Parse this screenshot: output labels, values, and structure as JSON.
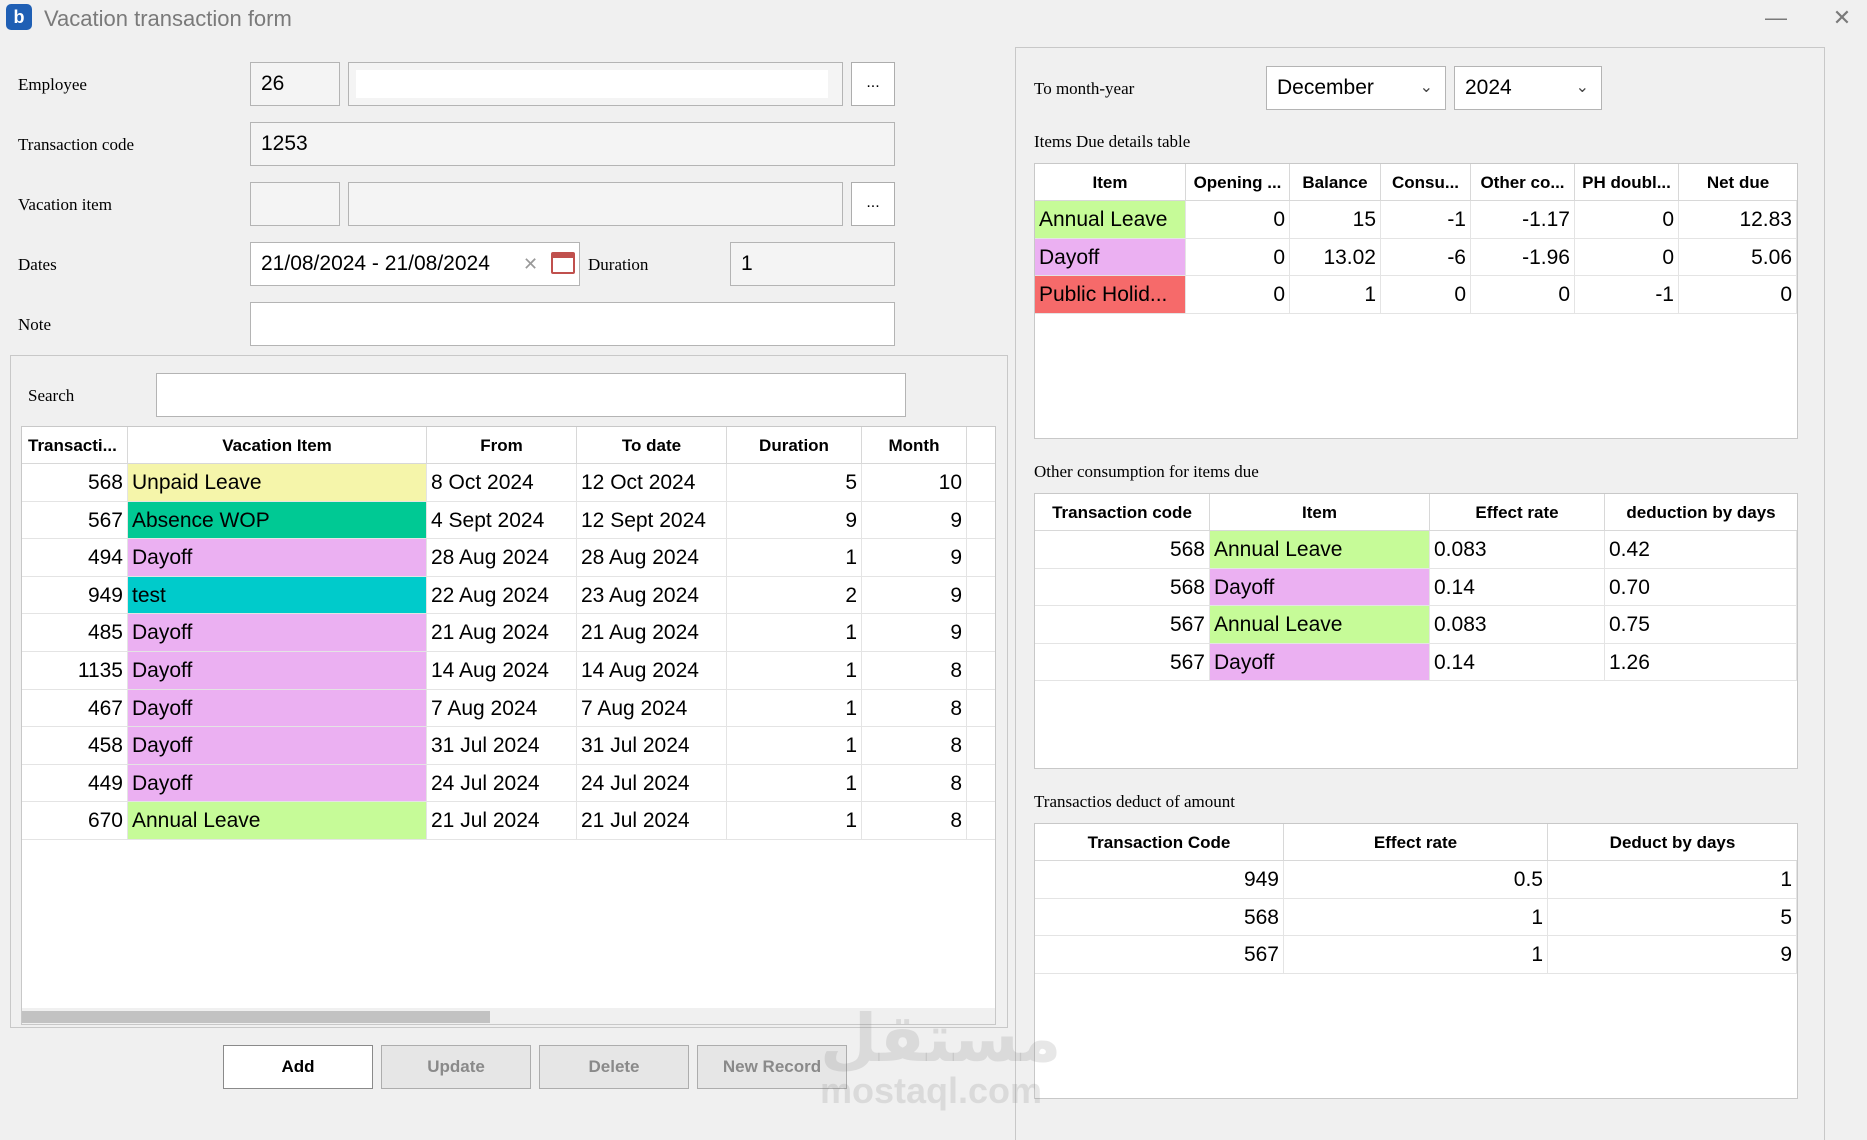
{
  "window": {
    "title": "Vacation transaction form",
    "app_icon": "app-logo-icon",
    "minimize": "—",
    "close": "✕"
  },
  "form": {
    "employee_label": "Employee",
    "employee_id": "26",
    "employee_name": "",
    "transaction_code_label": "Transaction code",
    "transaction_code": "1253",
    "vacation_item_label": "Vacation item",
    "vacation_item_code": "",
    "vacation_item_name": "",
    "dates_label": "Dates",
    "dates_value": "21/08/2024 - 21/08/2024",
    "duration_label": "Duration",
    "duration_value": "1",
    "note_label": "Note",
    "note_value": "",
    "browse": "..."
  },
  "search": {
    "label": "Search",
    "value": ""
  },
  "transactions": {
    "columns": [
      "Transacti...",
      "Vacation Item",
      "From",
      "To date",
      "Duration",
      "Month"
    ],
    "rows": [
      {
        "code": "568",
        "item": "Unpaid Leave",
        "color": "#f5f5aa",
        "from": "8 Oct 2024",
        "to": "12 Oct 2024",
        "duration": "5",
        "month": "10"
      },
      {
        "code": "567",
        "item": "Absence WOP",
        "color": "#00c994",
        "from": "4 Sept 2024",
        "to": "12 Sept 2024",
        "duration": "9",
        "month": "9"
      },
      {
        "code": "494",
        "item": "Dayoff",
        "color": "#ebb0f2",
        "from": "28 Aug 2024",
        "to": "28 Aug 2024",
        "duration": "1",
        "month": "9"
      },
      {
        "code": "949",
        "item": "test",
        "color": "#00cbcb",
        "from": "22 Aug 2024",
        "to": "23 Aug 2024",
        "duration": "2",
        "month": "9"
      },
      {
        "code": "485",
        "item": "Dayoff",
        "color": "#ebb0f2",
        "from": "21 Aug 2024",
        "to": "21 Aug 2024",
        "duration": "1",
        "month": "9"
      },
      {
        "code": "1135",
        "item": "Dayoff",
        "color": "#ebb0f2",
        "from": "14 Aug 2024",
        "to": "14 Aug 2024",
        "duration": "1",
        "month": "8"
      },
      {
        "code": "467",
        "item": "Dayoff",
        "color": "#ebb0f2",
        "from": "7 Aug 2024",
        "to": "7 Aug 2024",
        "duration": "1",
        "month": "8"
      },
      {
        "code": "458",
        "item": "Dayoff",
        "color": "#ebb0f2",
        "from": "31 Jul 2024",
        "to": "31 Jul 2024",
        "duration": "1",
        "month": "8"
      },
      {
        "code": "449",
        "item": "Dayoff",
        "color": "#ebb0f2",
        "from": "24 Jul 2024",
        "to": "24 Jul 2024",
        "duration": "1",
        "month": "8"
      },
      {
        "code": "670",
        "item": "Annual Leave",
        "color": "#c6fb98",
        "from": "21 Jul 2024",
        "to": "21 Jul 2024",
        "duration": "1",
        "month": "8"
      }
    ]
  },
  "buttons": {
    "add": "Add",
    "update": "Update",
    "delete": "Delete",
    "new_record": "New Record"
  },
  "right": {
    "to_month_year_label": "To month-year",
    "month": "December",
    "year": "2024",
    "items_due_title": "Items Due details table",
    "items_due": {
      "columns": [
        "Item",
        "Opening ...",
        "Balance",
        "Consu...",
        "Other co...",
        "PH doubl...",
        "Net due"
      ],
      "rows": [
        {
          "item": "Annual Leave",
          "color": "#c6fb98",
          "opening": "0",
          "balance": "15",
          "consumed": "-1",
          "other": "-1.17",
          "ph": "0",
          "net": "12.83"
        },
        {
          "item": "Dayoff",
          "color": "#ebb0f2",
          "opening": "0",
          "balance": "13.02",
          "consumed": "-6",
          "other": "-1.96",
          "ph": "0",
          "net": "5.06"
        },
        {
          "item": "Public Holid...",
          "color": "#f66a6a",
          "opening": "0",
          "balance": "1",
          "consumed": "0",
          "other": "0",
          "ph": "-1",
          "net": "0"
        }
      ]
    },
    "other_consumption_title": "Other consumption for items due",
    "other_consumption": {
      "columns": [
        "Transaction code",
        "Item",
        "Effect rate",
        "deduction by days"
      ],
      "rows": [
        {
          "code": "568",
          "item": "Annual Leave",
          "color": "#c6fb98",
          "rate": "0.083",
          "days": "0.42"
        },
        {
          "code": "568",
          "item": "Dayoff",
          "color": "#ebb0f2",
          "rate": "0.14",
          "days": "0.70"
        },
        {
          "code": "567",
          "item": "Annual Leave",
          "color": "#c6fb98",
          "rate": "0.083",
          "days": "0.75"
        },
        {
          "code": "567",
          "item": "Dayoff",
          "color": "#ebb0f2",
          "rate": "0.14",
          "days": "1.26"
        }
      ]
    },
    "deduct_title": "Transactios deduct of amount",
    "deduct": {
      "columns": [
        "Transaction Code",
        "Effect rate",
        "Deduct by days"
      ],
      "rows": [
        {
          "code": "949",
          "rate": "0.5",
          "days": "1"
        },
        {
          "code": "568",
          "rate": "1",
          "days": "5"
        },
        {
          "code": "567",
          "rate": "1",
          "days": "9"
        }
      ]
    }
  },
  "watermark": {
    "arabic": "مستقل",
    "latin": "mostaql.com"
  }
}
